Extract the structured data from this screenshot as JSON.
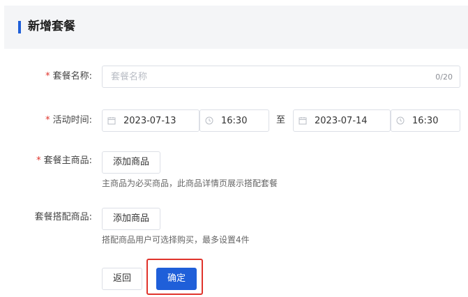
{
  "header": {
    "title": "新增套餐"
  },
  "form": {
    "name": {
      "required_mark": "*",
      "label": "套餐名称:",
      "placeholder": "套餐名称",
      "counter": "0/20"
    },
    "time": {
      "required_mark": "*",
      "label": "活动时间:",
      "start_date": "2023-07-13",
      "start_time": "16:30",
      "separator": "至",
      "end_date": "2023-07-14",
      "end_time": "16:30"
    },
    "main_product": {
      "required_mark": "*",
      "label": "套餐主商品:",
      "button": "添加商品",
      "hint": "主商品为必买商品，此商品详情页展示搭配套餐"
    },
    "combo_product": {
      "label": "套餐搭配商品:",
      "button": "添加商品",
      "hint": "搭配商品用户可选择购买，最多设置4件"
    }
  },
  "actions": {
    "back": "返回",
    "confirm": "确定"
  },
  "colors": {
    "accent": "#1f5fd9",
    "required": "#e0332b",
    "highlight": "#e0332b"
  },
  "icons": {
    "date": "calendar-icon",
    "time": "clock-icon"
  }
}
